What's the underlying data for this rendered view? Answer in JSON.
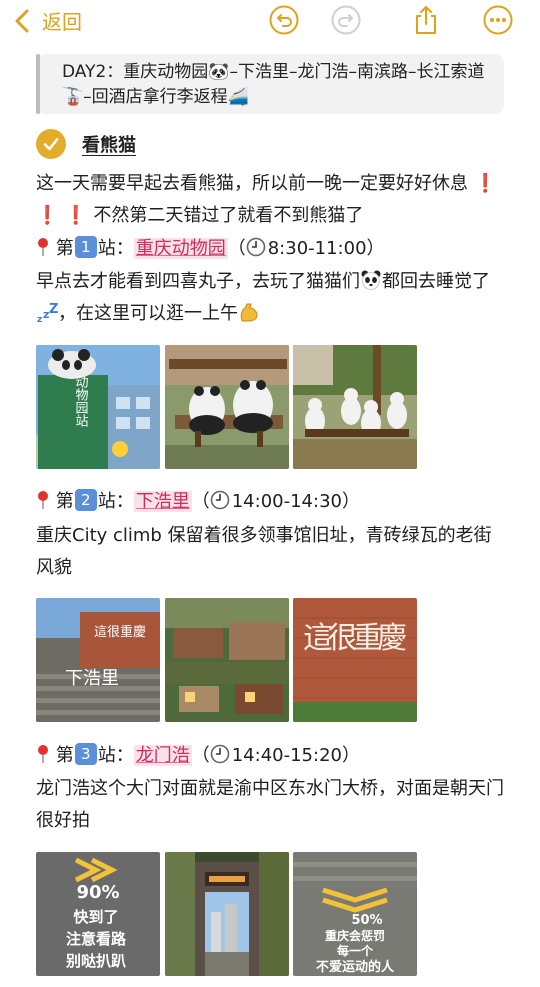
{
  "toolbar": {
    "back_label": "返回"
  },
  "intro": {
    "text": "DAY2：重庆动物园🐼–下浩里–龙门浩–南滨路–长江索道🚡–回酒店拿行李返程🚄"
  },
  "heading": {
    "title": "看熊猫"
  },
  "section1": {
    "para_a": "这一天需要早起去看熊猫，所以前一晚一定要好好休息",
    "para_b": "不然第二天错过了就看不到熊猫了",
    "stop_prefix": "第",
    "stop_num": "1",
    "stop_suffix": "站：",
    "stop_name": "重庆动物园",
    "paren_open": "（",
    "time": "8:30-11:00",
    "paren_close": "）",
    "desc_a": "早点去才能看到四喜丸子，去玩了猫猫们",
    "desc_b": "都回去睡觉了",
    "desc_c": "，在这里可以逛一上午",
    "photo1_sign": "动物园站"
  },
  "section2": {
    "stop_prefix": "第",
    "stop_num": "2",
    "stop_suffix": "站：",
    "stop_name": "下浩里",
    "paren_open": "（",
    "time": "14:00-14:30",
    "paren_close": "）",
    "desc": "重庆City climb 保留着很多领事馆旧址，青砖绿瓦的老街风貌",
    "photo1_sign": "這很重慶",
    "photo1_ground": "下浩里",
    "photo3_sign": "這很重慶"
  },
  "section3": {
    "stop_prefix": "第",
    "stop_num": "3",
    "stop_suffix": "站：",
    "stop_name": "龙门浩",
    "paren_open": "（",
    "time": "14:40-15:20",
    "paren_close": "）",
    "desc": "龙门浩这个大门对面就是渝中区东水门大桥，对面是朝天门很好拍",
    "photo1_pct": "90%",
    "photo1_line1": "快到了",
    "photo1_line2": "注意看路",
    "photo1_line3": "别哒扒趴",
    "photo3_pct": "50%",
    "photo3_line1": "重庆会惩罚",
    "photo3_line2": "每一个",
    "photo3_line3": "不爱运动的人"
  },
  "colors": {
    "accent": "#e0a21e",
    "link_pink": "#d12b5a",
    "number_badge": "#5b8fd8"
  },
  "icons": [
    "chevron-left-icon",
    "undo-icon",
    "redo-icon",
    "share-icon",
    "more-icon",
    "checkmark-icon",
    "pin-icon",
    "clock-icon",
    "panda-icon",
    "sleep-icon",
    "muscle-icon",
    "exclamation-icon"
  ]
}
